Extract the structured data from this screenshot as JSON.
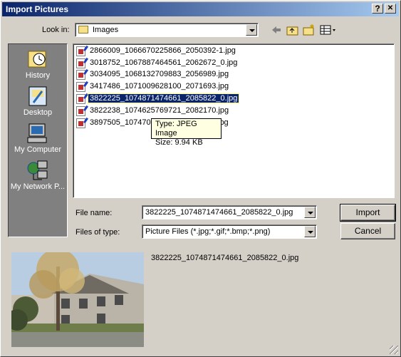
{
  "window": {
    "title": "Import Pictures",
    "help_glyph": "?",
    "close_glyph": "✕"
  },
  "lookin": {
    "label": "Look in:",
    "value": "Images"
  },
  "places": [
    {
      "label": "History",
      "icon": "history-icon"
    },
    {
      "label": "Desktop",
      "icon": "desktop-icon"
    },
    {
      "label": "My Computer",
      "icon": "my-computer-icon"
    },
    {
      "label": "My Network P...",
      "icon": "my-network-places-icon"
    }
  ],
  "files": [
    {
      "name": "2866009_1066670225866_2050392-1.jpg",
      "selected": false
    },
    {
      "name": "3018752_1067887464561_2062672_0.jpg",
      "selected": false
    },
    {
      "name": "3034095_1068132709883_2056989.jpg",
      "selected": false
    },
    {
      "name": "3417486_1071009628100_2071693.jpg",
      "selected": false
    },
    {
      "name": "3822225_1074871474661_2085822_0.jpg",
      "selected": true
    },
    {
      "name": "3822238_1074625769721_2082170.jpg",
      "selected": false
    },
    {
      "name": "3897505_1074708",
      "suffix": "jpg",
      "selected": false
    }
  ],
  "tooltip": {
    "type": "Type: JPEG Image",
    "size": "Size: 9.94 KB"
  },
  "filename": {
    "label": "File name:",
    "value": "3822225_1074871474661_2085822_0.jpg"
  },
  "filetype": {
    "label": "Files of type:",
    "value": "Picture Files (*.jpg;*.gif;*.bmp;*.png)"
  },
  "buttons": {
    "import": "Import",
    "cancel": "Cancel"
  },
  "preview": {
    "caption": "3822225_1074871474661_2085822_0.jpg"
  }
}
